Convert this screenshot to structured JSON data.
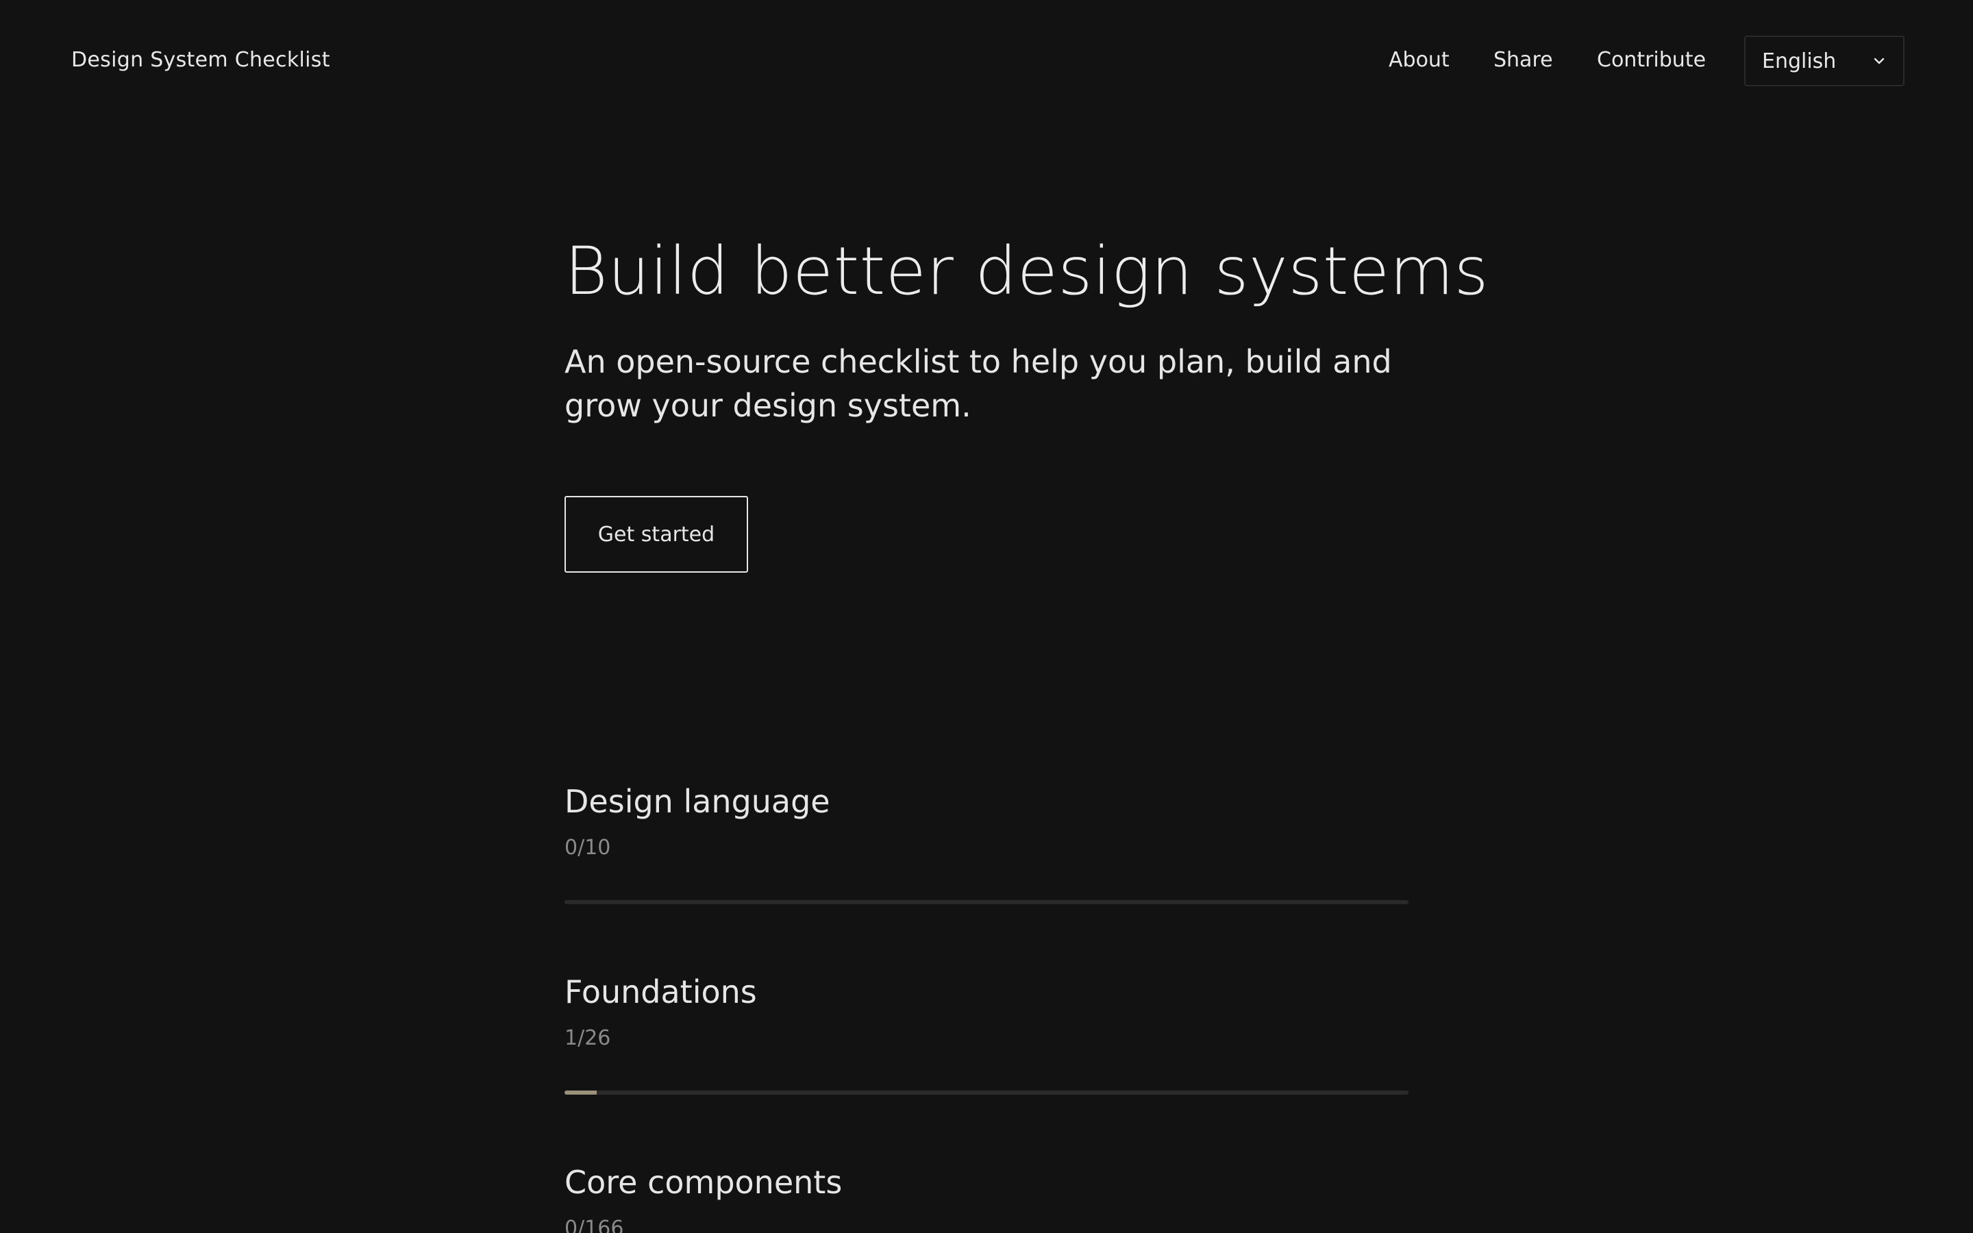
{
  "header": {
    "brand": "Design System Checklist",
    "nav": [
      {
        "label": "About"
      },
      {
        "label": "Share"
      },
      {
        "label": "Contribute"
      }
    ],
    "language": {
      "selected": "English"
    }
  },
  "hero": {
    "title": "Build better design systems",
    "subtitle": "An open-source checklist to help you plan, build and grow your design system.",
    "cta_label": "Get started"
  },
  "sections": [
    {
      "title": "Design language",
      "count": "0/10",
      "progress": 0.0
    },
    {
      "title": "Foundations",
      "count": "1/26",
      "progress": 0.0385
    },
    {
      "title": "Core components",
      "count": "0/166",
      "progress": 0.0
    }
  ],
  "colors": {
    "background": "#121212",
    "text": "#e8e8e8",
    "muted": "#8a8a8a",
    "track": "#2a2a2a",
    "accent": "#9b917a"
  }
}
